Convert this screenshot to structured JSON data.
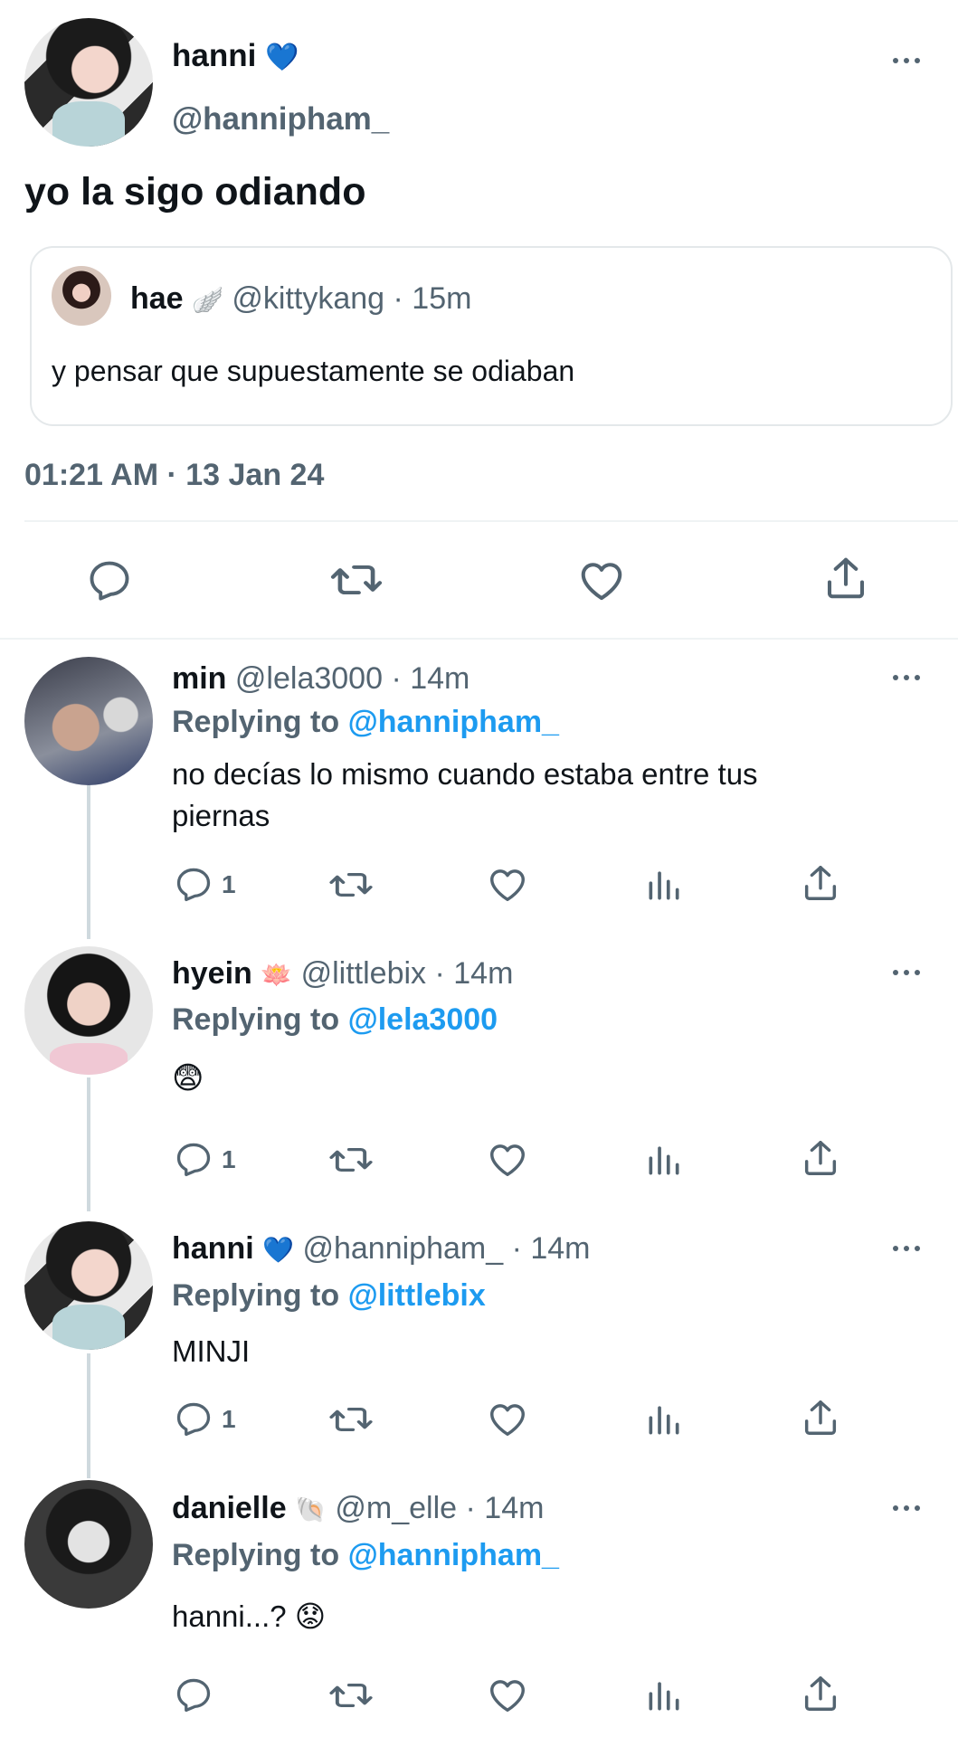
{
  "main_tweet": {
    "display_name": "hanni",
    "name_emoji": "💙",
    "handle": "@hannipham_",
    "text": "yo la sigo odiando",
    "timestamp": "01:21 AM · 13 Jan 24",
    "quoted": {
      "display_name": "hae",
      "name_emoji": "🪽",
      "handle": "@kittykang",
      "time": "· 15m",
      "text": "y pensar que supuestamente se odiaban"
    }
  },
  "replies": [
    {
      "display_name": "min",
      "name_emoji": "",
      "handle": "@lela3000",
      "time": "· 14m",
      "replying_label": "Replying to",
      "replying_to": "@hannipham_",
      "text_line1": "no decías lo mismo cuando estaba entre tus",
      "text_line2": "piernas",
      "reply_count": "1"
    },
    {
      "display_name": "hyein",
      "name_emoji": "🪷",
      "handle": "@littlebix",
      "time": "· 14m",
      "replying_label": "Replying to",
      "replying_to": "@lela3000",
      "text": "😨",
      "reply_count": "1"
    },
    {
      "display_name": "hanni",
      "name_emoji": "💙",
      "handle": "@hannipham_",
      "time": "· 14m",
      "replying_label": "Replying to",
      "replying_to": "@littlebix",
      "text": "MINJI",
      "reply_count": "1"
    },
    {
      "display_name": "danielle",
      "name_emoji": "🐚",
      "handle": "@m_elle",
      "time": "· 14m",
      "replying_label": "Replying to",
      "replying_to": "@hannipham_",
      "text": "hanni...? 😟",
      "reply_count": ""
    }
  ],
  "icons": [
    "reply-icon",
    "retweet-icon",
    "like-icon",
    "views-icon",
    "share-icon",
    "more-icon"
  ],
  "colors": {
    "accent": "#1d9bf0",
    "secondary_text": "#536471",
    "primary_text": "#0f1419",
    "thread_line": "#cfd9de"
  }
}
